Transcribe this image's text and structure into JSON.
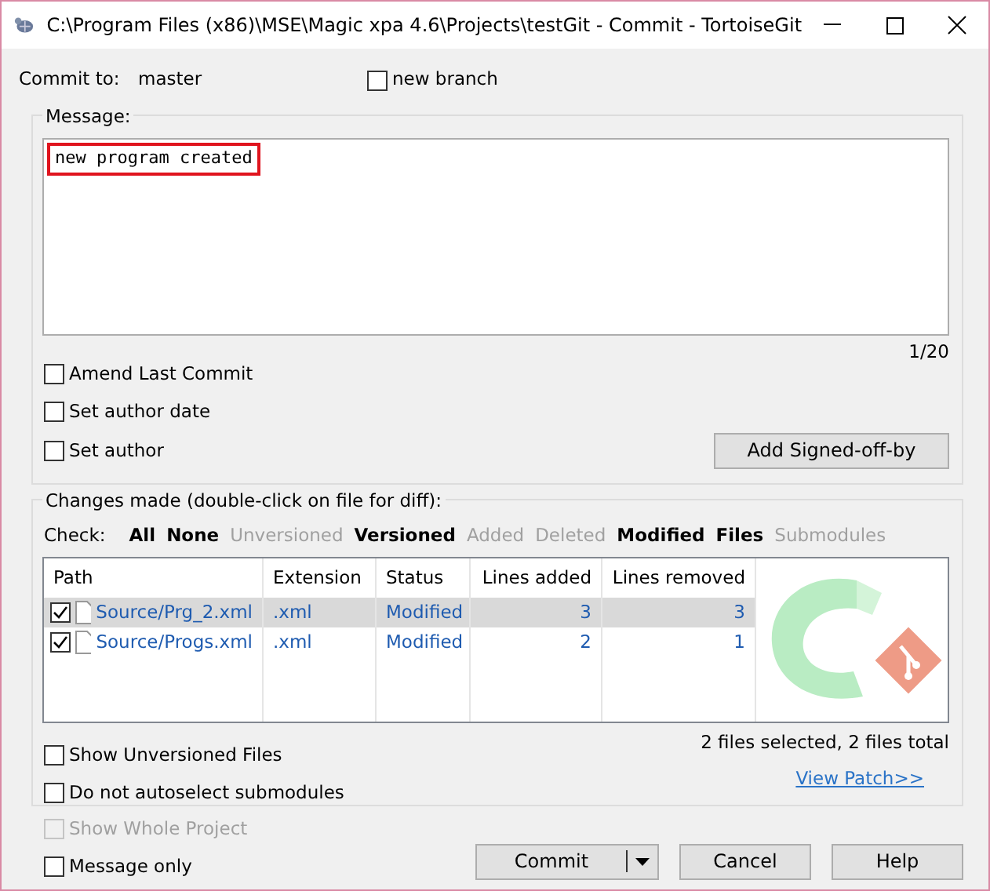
{
  "window": {
    "title": "C:\\Program Files (x86)\\MSE\\Magic xpa 4.6\\Projects\\testGit - Commit - TortoiseGit"
  },
  "commit_to": {
    "label": "Commit to:",
    "branch": "master",
    "new_branch": {
      "label": "new branch",
      "checked": false
    }
  },
  "message": {
    "legend": "Message:",
    "text": "new program created",
    "highlighted": true,
    "counter": "1/20"
  },
  "options": [
    {
      "label": "Amend Last Commit",
      "checked": false
    },
    {
      "label": "Set author date",
      "checked": false
    },
    {
      "label": "Set author",
      "checked": false
    }
  ],
  "signoff_button": "Add Signed-off-by",
  "changes": {
    "legend": "Changes made (double-click on file for diff):",
    "check_label": "Check:",
    "filters": [
      {
        "label": "All",
        "enabled": true
      },
      {
        "label": "None",
        "enabled": true
      },
      {
        "label": "Unversioned",
        "enabled": false
      },
      {
        "label": "Versioned",
        "enabled": true
      },
      {
        "label": "Added",
        "enabled": false
      },
      {
        "label": "Deleted",
        "enabled": false
      },
      {
        "label": "Modified",
        "enabled": true
      },
      {
        "label": "Files",
        "enabled": true
      },
      {
        "label": "Submodules",
        "enabled": false
      }
    ],
    "columns": [
      "Path",
      "Extension",
      "Status",
      "Lines added",
      "Lines removed"
    ],
    "rows": [
      {
        "checked": true,
        "selected": true,
        "path": "Source/Prg_2.xml",
        "extension": ".xml",
        "status": "Modified",
        "lines_added": "3",
        "lines_removed": "3"
      },
      {
        "checked": true,
        "selected": false,
        "path": "Source/Progs.xml",
        "extension": ".xml",
        "status": "Modified",
        "lines_added": "2",
        "lines_removed": "1"
      }
    ],
    "bottom_options": [
      {
        "label": "Show Unversioned Files",
        "checked": false
      },
      {
        "label": "Do not autoselect submodules",
        "checked": false
      }
    ],
    "summary": "2 files selected, 2 files total",
    "view_patch": "View Patch>>"
  },
  "footer_options": [
    {
      "label": "Show Whole Project",
      "checked": false,
      "disabled": true
    },
    {
      "label": "Message only",
      "checked": false,
      "disabled": false
    }
  ],
  "buttons": [
    {
      "kind": "split",
      "label": "Commit"
    },
    {
      "kind": "plain",
      "label": "Cancel"
    },
    {
      "kind": "plain",
      "label": "Help"
    }
  ]
}
